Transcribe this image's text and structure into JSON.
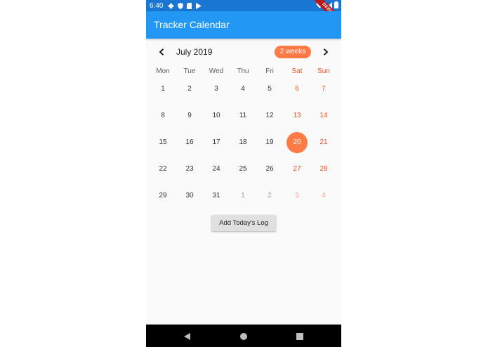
{
  "status_bar": {
    "time": "6:40",
    "icons": [
      "gear-icon",
      "shield-icon",
      "sd-card-icon",
      "play-icon",
      "wifi-icon",
      "signal-icon",
      "battery-icon"
    ]
  },
  "debug_banner": "DEBUG",
  "app_bar": {
    "title": "Tracker Calendar"
  },
  "calendar": {
    "month_label": "July 2019",
    "format_button": "2 weeks",
    "weekdays": [
      "Mon",
      "Tue",
      "Wed",
      "Thu",
      "Fri",
      "Sat",
      "Sun"
    ],
    "weeks": [
      [
        "1",
        "2",
        "3",
        "4",
        "5",
        "6",
        "7"
      ],
      [
        "8",
        "9",
        "10",
        "11",
        "12",
        "13",
        "14"
      ],
      [
        "15",
        "16",
        "17",
        "18",
        "19",
        "20",
        "21"
      ],
      [
        "22",
        "23",
        "24",
        "25",
        "26",
        "27",
        "28"
      ],
      [
        "29",
        "30",
        "31",
        "1",
        "2",
        "3",
        "4"
      ]
    ],
    "selected_day": "20",
    "accent_color": "#ff7a45",
    "weekend_color": "#f4511e"
  },
  "actions": {
    "add_log_label": "Add Today's Log"
  },
  "colors": {
    "status_bar": "#1976d2",
    "app_bar": "#2196f3",
    "background": "#fafafa"
  }
}
